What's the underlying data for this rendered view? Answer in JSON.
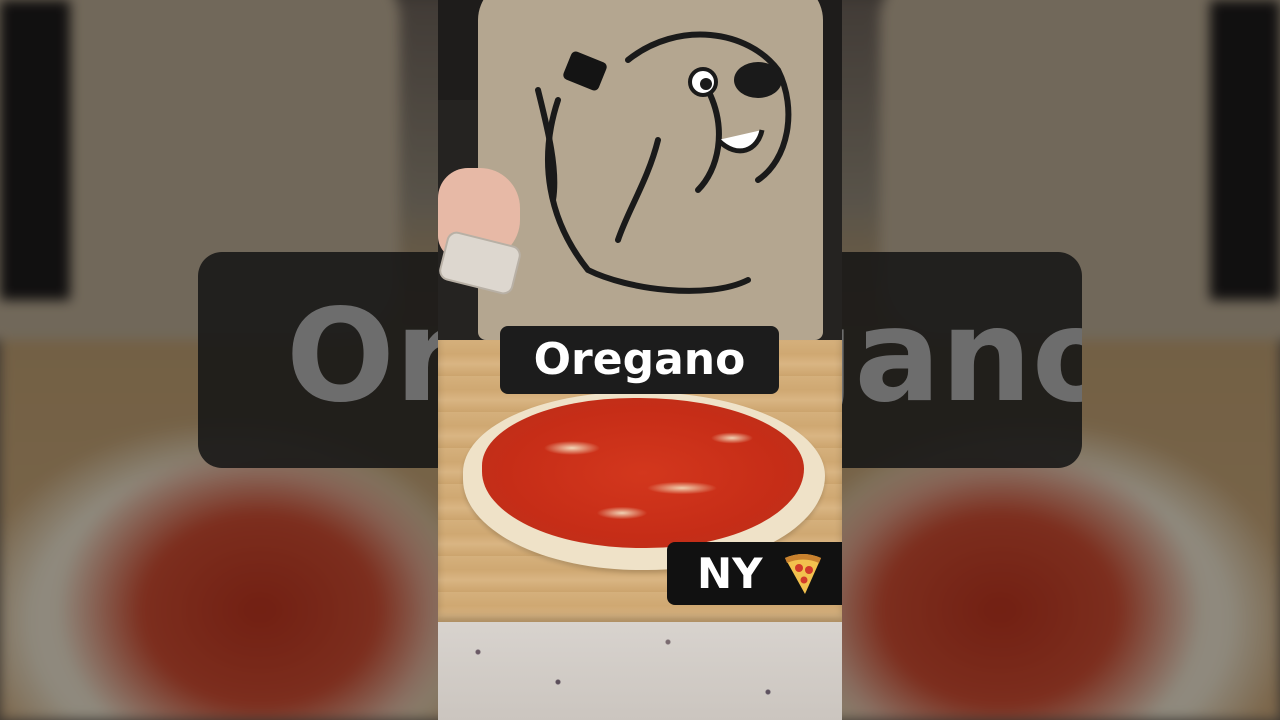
{
  "scene": {
    "caption_top": "Oregano",
    "caption_bottom": "NY",
    "background_ghost_text": "Oregano",
    "icons": [
      "pizza-slice-icon"
    ],
    "colors": {
      "caption_bg": "#1c1c1c",
      "caption_text": "#ffffff",
      "sauce": "#c62d17",
      "dough": "#efe2c8",
      "board": "#d5b07c",
      "apron": "#b4a690"
    }
  }
}
